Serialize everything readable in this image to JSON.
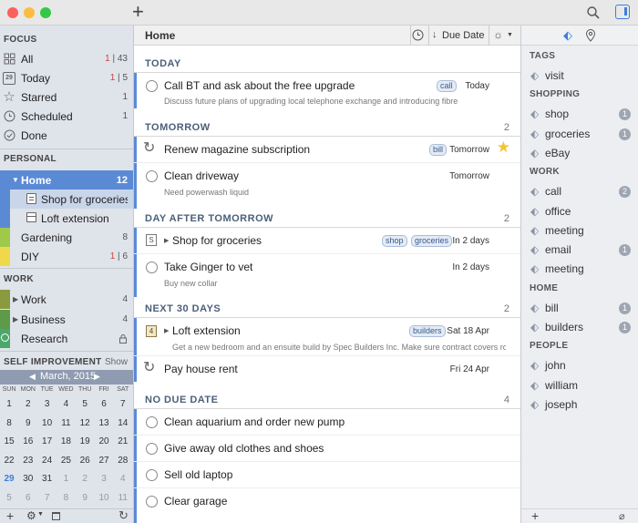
{
  "toolbar": {
    "add_label": "+"
  },
  "sidebar": {
    "focus_header": "FOCUS",
    "focus": [
      {
        "label": "All",
        "count_red": "1",
        "count": "43"
      },
      {
        "label": "Today",
        "count_red": "1",
        "count": "5"
      },
      {
        "label": "Starred",
        "count_red": "",
        "count": "1"
      },
      {
        "label": "Scheduled",
        "count_red": "",
        "count": "1"
      },
      {
        "label": "Done",
        "count_red": "",
        "count": ""
      }
    ],
    "personal_header": "PERSONAL",
    "home": {
      "label": "Home",
      "count": "12"
    },
    "home_children": [
      "Shop for groceries",
      "Loft extension"
    ],
    "personal": [
      {
        "label": "Gardening",
        "count_red": "",
        "count": "8"
      },
      {
        "label": "DIY",
        "count_red": "1",
        "count": "6"
      }
    ],
    "work_header": "WORK",
    "work": [
      {
        "label": "Work",
        "count": "4"
      },
      {
        "label": "Business",
        "count": "4"
      },
      {
        "label": "Research",
        "count": ""
      }
    ],
    "self_header": "SELF IMPROVEMENT",
    "self_show": "Show"
  },
  "calendar": {
    "month": "March, 2015",
    "weekdays": [
      "SUN",
      "MON",
      "TUE",
      "WED",
      "THU",
      "FRI",
      "SAT"
    ],
    "weeks": [
      [
        "1",
        "2",
        "3",
        "4",
        "5",
        "6",
        "7"
      ],
      [
        "8",
        "9",
        "10",
        "11",
        "12",
        "13",
        "14"
      ],
      [
        "15",
        "16",
        "17",
        "18",
        "19",
        "20",
        "21"
      ],
      [
        "22",
        "23",
        "24",
        "25",
        "26",
        "27",
        "28"
      ],
      [
        "29",
        "30",
        "31",
        "1",
        "2",
        "3",
        "4"
      ],
      [
        "5",
        "6",
        "7",
        "8",
        "9",
        "10",
        "11"
      ]
    ]
  },
  "main": {
    "title": "Home",
    "sort_label": "Due Date",
    "sections": [
      {
        "label": "TODAY",
        "count": ""
      },
      {
        "label": "TOMORROW",
        "count": "2"
      },
      {
        "label": "DAY AFTER TOMORROW",
        "count": "2"
      },
      {
        "label": "NEXT 30 DAYS",
        "count": "2"
      },
      {
        "label": "NO DUE DATE",
        "count": "4"
      }
    ],
    "tasks": [
      {
        "title": "Call BT and ask about the free upgrade",
        "note": "Discuss future plans of upgrading local telephone exchange and introducing fibre",
        "tags": [
          "call"
        ],
        "date": "Today"
      },
      {
        "title": "Renew magazine subscription",
        "note": "",
        "tags": [
          "bill"
        ],
        "date": "Tomorrow"
      },
      {
        "title": "Clean driveway",
        "note": "Need powerwash liquid",
        "tags": [],
        "date": "Tomorrow"
      },
      {
        "title": "Shop for groceries",
        "note": "",
        "tags": [
          "shop",
          "groceries"
        ],
        "date": "In 2 days"
      },
      {
        "title": "Take Ginger to vet",
        "note": "Buy new collar",
        "tags": [],
        "date": "In 2 days"
      },
      {
        "title": "Loft extension",
        "note": "Get a new bedroom and an ensuite build by Spec Builders Inc. Make sure contract covers roof",
        "tags": [
          "builders"
        ],
        "date": "Sat 18 Apr"
      },
      {
        "title": "Pay house rent",
        "note": "",
        "tags": [],
        "date": "Fri 24 Apr"
      },
      {
        "title": "Clean aquarium and order new pump",
        "note": "",
        "tags": [],
        "date": ""
      },
      {
        "title": "Give away old clothes and shoes",
        "note": "",
        "tags": [],
        "date": ""
      },
      {
        "title": "Sell old laptop",
        "note": "",
        "tags": [],
        "date": ""
      },
      {
        "title": "Clear garage",
        "note": "",
        "tags": [],
        "date": ""
      }
    ],
    "loft_badge": "4"
  },
  "tags_panel": {
    "sections": [
      {
        "header": "TAGS",
        "items": [
          {
            "label": "visit",
            "badge": ""
          }
        ]
      },
      {
        "header": "SHOPPING",
        "items": [
          {
            "label": "shop",
            "badge": "1"
          },
          {
            "label": "groceries",
            "badge": "1"
          },
          {
            "label": "eBay",
            "badge": ""
          }
        ]
      },
      {
        "header": "WORK",
        "items": [
          {
            "label": "call",
            "badge": "2"
          },
          {
            "label": "office",
            "badge": ""
          },
          {
            "label": "meeting",
            "badge": ""
          },
          {
            "label": "email",
            "badge": "1"
          },
          {
            "label": "meeting",
            "badge": ""
          }
        ]
      },
      {
        "header": "HOME",
        "items": [
          {
            "label": "bill",
            "badge": "1"
          },
          {
            "label": "builders",
            "badge": "1"
          }
        ]
      },
      {
        "header": "PEOPLE",
        "items": [
          {
            "label": "john",
            "badge": ""
          },
          {
            "label": "william",
            "badge": ""
          },
          {
            "label": "joseph",
            "badge": ""
          }
        ]
      }
    ]
  },
  "colors": {
    "accent": "#5b8ad5",
    "home_selected": "#5b8ad5",
    "close": "#fc605b",
    "min": "#fdbc40",
    "max": "#34c84a",
    "star": "#f4c430"
  }
}
